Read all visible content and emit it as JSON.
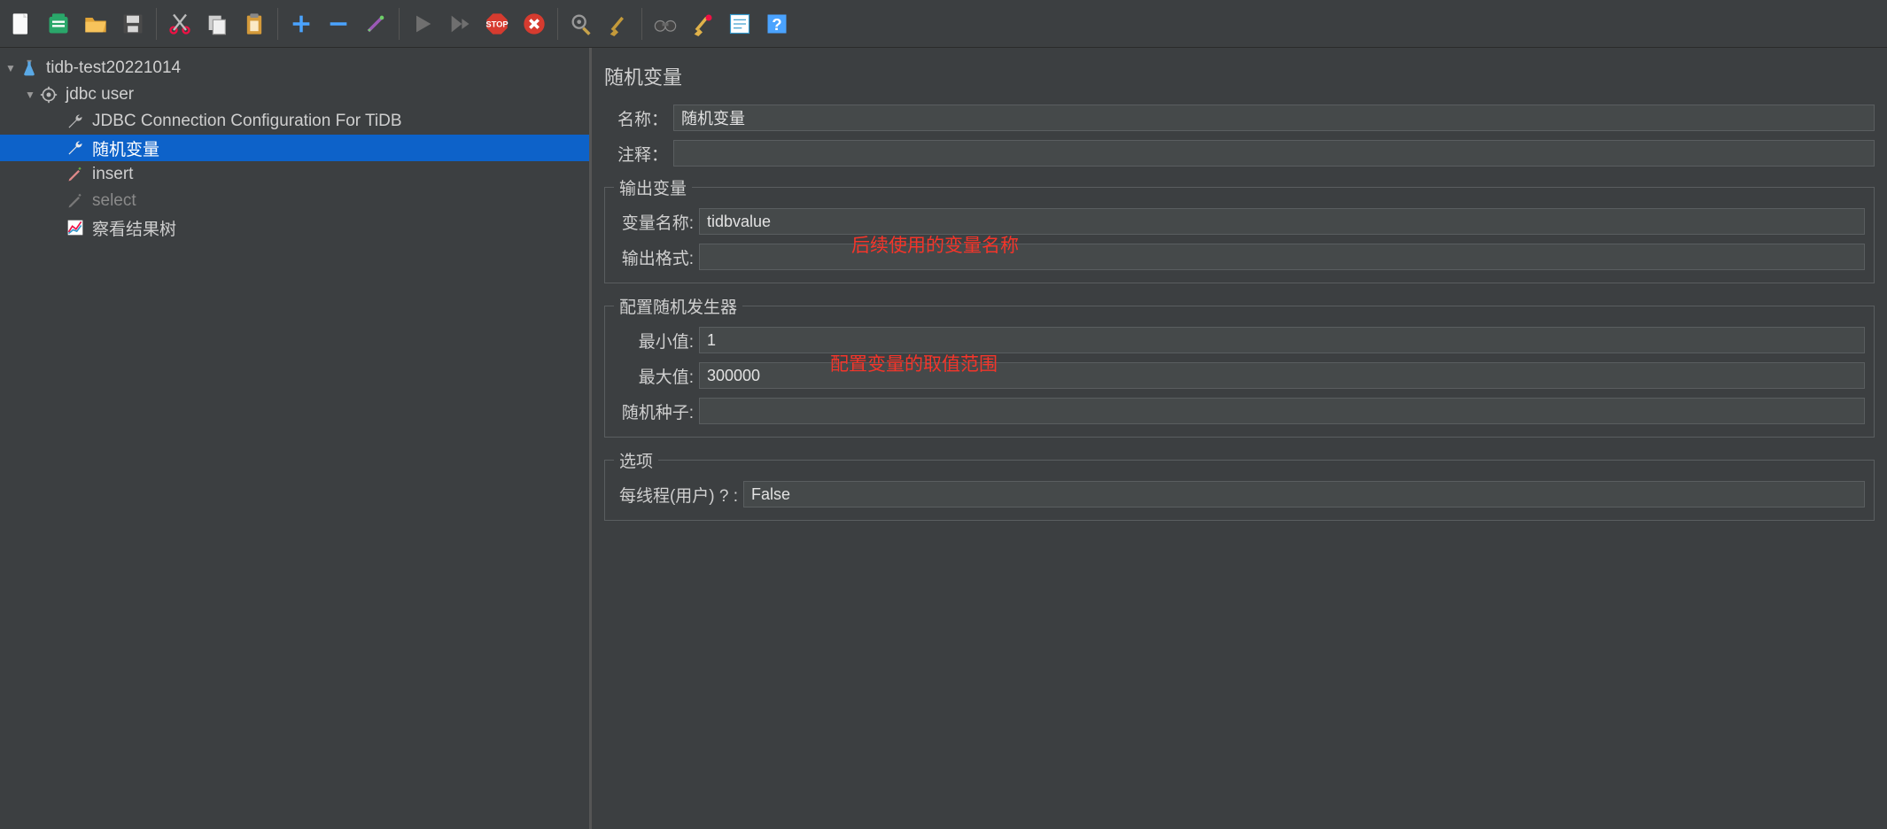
{
  "toolbar_icons": [
    "file-new-icon",
    "templates-icon",
    "folder-open-icon",
    "save-icon",
    "sep",
    "cut-icon",
    "copy-icon",
    "paste-icon",
    "sep",
    "add-icon",
    "remove-icon",
    "wand-icon",
    "sep",
    "play-icon",
    "play-next-icon",
    "stop-icon",
    "close-icon",
    "sep",
    "gear-sweep-icon",
    "broom-icon",
    "sep",
    "binoculars-icon",
    "broom2-icon",
    "toggle-icon",
    "help-icon"
  ],
  "tree": {
    "root": {
      "label": "tidb-test20221014"
    },
    "thread_group": {
      "label": "jdbc user"
    },
    "items": [
      {
        "label": "JDBC Connection Configuration For TiDB",
        "icon": "wrench",
        "sel": false,
        "dim": false
      },
      {
        "label": "随机变量",
        "icon": "wrench",
        "sel": true,
        "dim": false
      },
      {
        "label": "insert",
        "icon": "pencil",
        "sel": false,
        "dim": false
      },
      {
        "label": "select",
        "icon": "pencil",
        "sel": false,
        "dim": true
      },
      {
        "label": "察看结果树",
        "icon": "chart",
        "sel": false,
        "dim": false
      }
    ]
  },
  "panel": {
    "title": "随机变量",
    "name_label": "名称：",
    "name_value": "随机变量",
    "comment_label": "注释：",
    "comment_value": "",
    "output_legend": "输出变量",
    "var_name_label": "变量名称:",
    "var_name_value": "tidbvalue",
    "out_fmt_label": "输出格式:",
    "out_fmt_value": "",
    "rand_legend": "配置随机发生器",
    "min_label": "最小值:",
    "min_value": "1",
    "max_label": "最大值:",
    "max_value": "300000",
    "seed_label": "随机种子:",
    "seed_value": "",
    "opt_legend": "选项",
    "per_thread_label": "每线程(用户) ? :",
    "per_thread_value": "False"
  },
  "annotations": {
    "var_name": "后续使用的变量名称",
    "range": "配置变量的取值范围"
  }
}
